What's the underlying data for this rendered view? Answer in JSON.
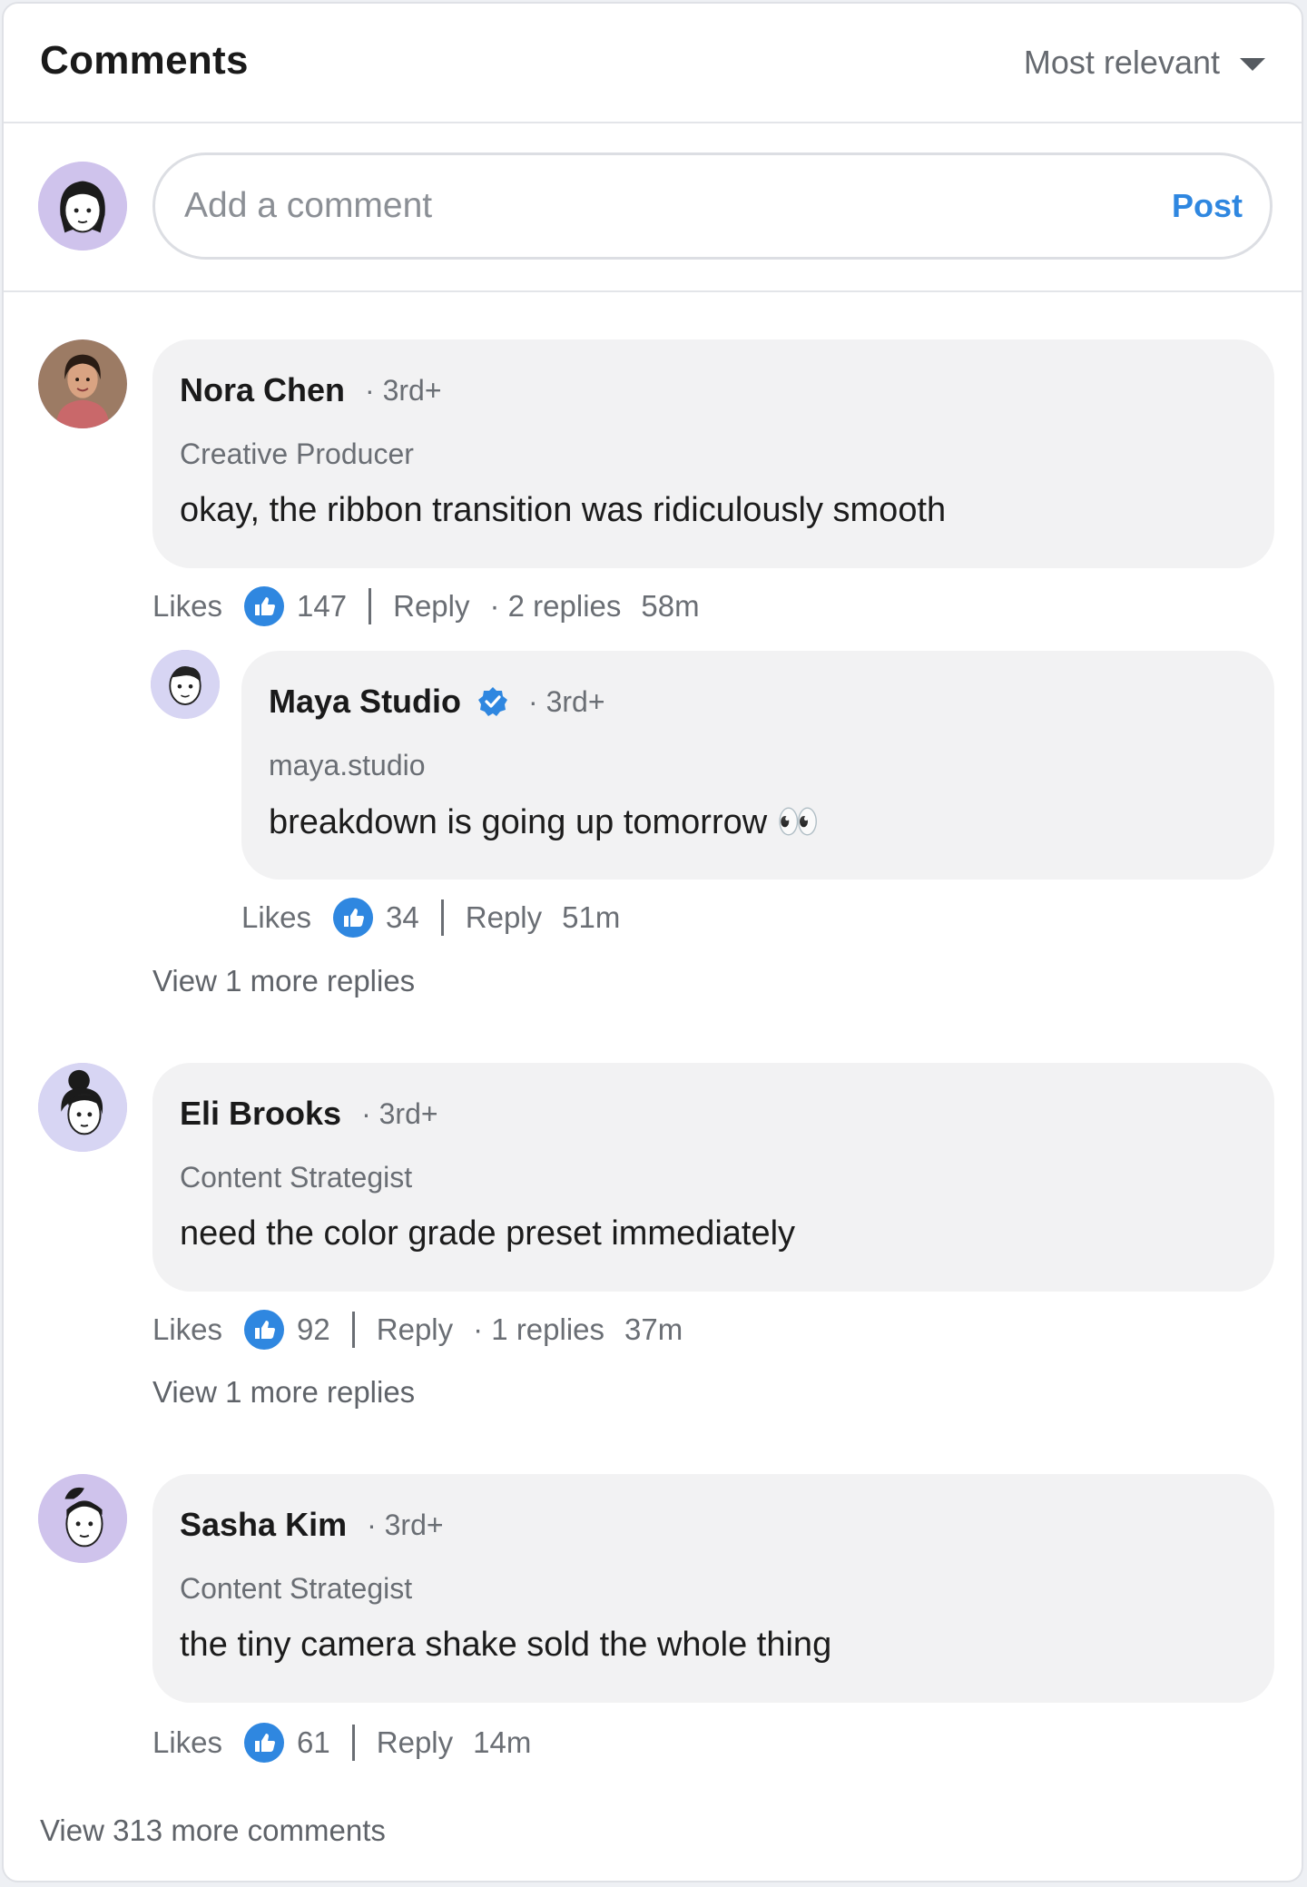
{
  "header": {
    "title": "Comments",
    "sort_label": "Most relevant"
  },
  "composer": {
    "placeholder": "Add a comment",
    "post_label": "Post"
  },
  "comments": [
    {
      "author": "Nora Chen",
      "degree": "· 3rd+",
      "headline": "Creative Producer",
      "text": "okay, the ribbon transition was ridiculously smooth",
      "likes_label": "Likes",
      "likes": "147",
      "reply_label": "Reply",
      "replies_count": "· 2 replies",
      "time": "58m",
      "reply": {
        "author": "Maya Studio",
        "degree": "· 3rd+",
        "headline": "maya.studio",
        "text": "breakdown is going up tomorrow 👀",
        "likes_label": "Likes",
        "likes": "34",
        "reply_label": "Reply",
        "time": "51m"
      },
      "view_more": "View 1 more replies"
    },
    {
      "author": "Eli Brooks",
      "degree": "· 3rd+",
      "headline": "Content Strategist",
      "text": "need the color grade preset immediately",
      "likes_label": "Likes",
      "likes": "92",
      "reply_label": "Reply",
      "replies_count": "· 1 replies",
      "time": "37m",
      "view_more": "View 1 more replies"
    },
    {
      "author": "Sasha Kim",
      "degree": "· 3rd+",
      "headline": "Content Strategist",
      "text": "the tiny camera shake sold the whole thing",
      "likes_label": "Likes",
      "likes": "61",
      "reply_label": "Reply",
      "time": "14m"
    }
  ],
  "footer": {
    "view_more_comments": "View 313 more comments"
  },
  "colors": {
    "accent": "#2f87e0",
    "bubble": "#f2f2f3",
    "avatar_bg": "#cfc3ec"
  },
  "icons": [
    "chevron-down-icon",
    "like-thumb-icon",
    "verified-badge-icon"
  ]
}
